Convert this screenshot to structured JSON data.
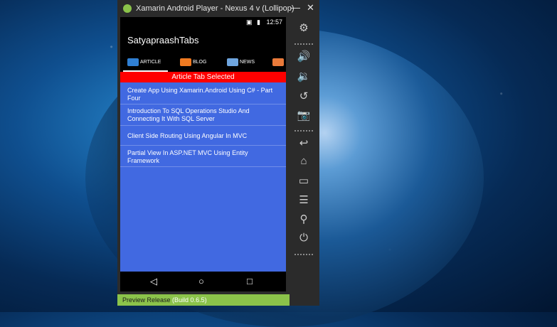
{
  "window": {
    "title": "Xamarin Android Player - Nexus 4 v (Lollipop)",
    "minimize": "—",
    "close": "✕"
  },
  "status": {
    "icons": "▣ ▮",
    "time": "12:57"
  },
  "app": {
    "title": "SatyapraashTabs",
    "tabs": [
      {
        "label": "ARTICLE",
        "icon": "article-icon",
        "color": "#2f7fd3"
      },
      {
        "label": "BLOG",
        "icon": "blog-icon",
        "color": "#f07a21"
      },
      {
        "label": "NEWS",
        "icon": "news-icon",
        "color": "#6fa5df"
      },
      {
        "label": "",
        "icon": "misc-icon",
        "color": "#e97a3a"
      }
    ],
    "banner": "Article Tab Selected",
    "items": [
      "Create App Using Xamarin.Android Using C# - Part Four",
      "Introduction To SQL Operations Studio And Connecting It With SQL Server",
      "Client Side Routing Using Angular In MVC",
      "Partial View In ASP.NET MVC Using Entity Framework"
    ]
  },
  "nav": {
    "back": "◁",
    "home": "○",
    "recents": "□"
  },
  "sidebar": [
    {
      "name": "settings-icon",
      "glyph": "⚙"
    },
    {
      "name": "volume-up-icon",
      "glyph": "🔊"
    },
    {
      "name": "volume-down-icon",
      "glyph": "🔉"
    },
    {
      "name": "rotate-icon",
      "glyph": "↺"
    },
    {
      "name": "camera-icon",
      "glyph": "📷"
    },
    {
      "name": "back-icon",
      "glyph": "↩"
    },
    {
      "name": "home-icon",
      "glyph": "⌂"
    },
    {
      "name": "recents-icon",
      "glyph": "▭"
    },
    {
      "name": "menu-icon",
      "glyph": "☰"
    },
    {
      "name": "search-icon",
      "glyph": "⚲"
    },
    {
      "name": "power-icon",
      "glyph": "⏻"
    }
  ],
  "footer": {
    "label": "Preview Release",
    "version": "(Build 0.6.5)"
  },
  "colors": {
    "accent": "#8bc34a",
    "banner": "#ff0000",
    "list_bg": "#4169e1"
  }
}
